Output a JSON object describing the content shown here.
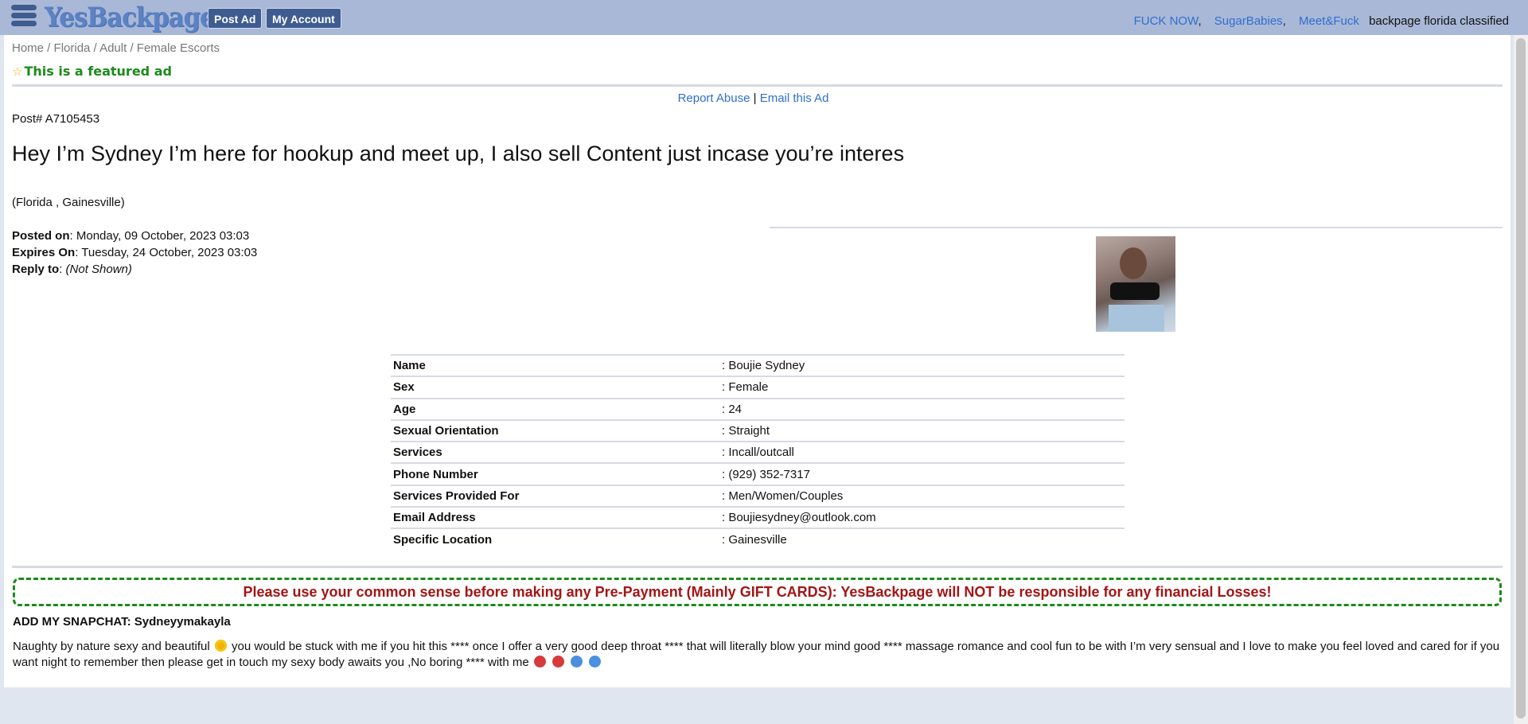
{
  "header": {
    "logo": "YesBackpage",
    "post_ad": "Post Ad",
    "my_account": "My Account",
    "links": [
      "FUCK NOW",
      "SugarBabies",
      "Meet&Fuck"
    ],
    "tagline": "backpage florida classified"
  },
  "breadcrumb": [
    "Home",
    "Florida",
    "Adult",
    "Female Escorts"
  ],
  "featured": "This is a featured ad",
  "actions": {
    "report": "Report Abuse",
    "email": "Email this Ad"
  },
  "post_number": "Post# A7105453",
  "title": "Hey I’m Sydney I’m here for hookup and meet up, I also sell Content just incase you’re interes",
  "location": "(Florida , Gainesville)",
  "meta": {
    "posted_label": "Posted on",
    "posted_value": ": Monday, 09 October, 2023  03:03",
    "expires_label": "Expires On",
    "expires_value": ": Tuesday, 24 October, 2023  03:03",
    "reply_label": "Reply to",
    "reply_value": "(Not Shown)"
  },
  "details": [
    {
      "k": "Name",
      "v": ": Boujie Sydney"
    },
    {
      "k": "Sex",
      "v": ": Female"
    },
    {
      "k": "Age",
      "v": ": 24"
    },
    {
      "k": "Sexual Orientation",
      "v": ": Straight"
    },
    {
      "k": "Services",
      "v": ": Incall/outcall"
    },
    {
      "k": "Phone Number",
      "v": ": (929) 352-7317"
    },
    {
      "k": "Services Provided For",
      "v": ": Men/Women/Couples"
    },
    {
      "k": "Email Address",
      "v": ": Boujiesydney@outlook.com"
    },
    {
      "k": "Specific Location",
      "v": ": Gainesville"
    }
  ],
  "warning": "Please use your common sense before making any Pre-Payment (Mainly GIFT CARDS): YesBackpage will NOT be responsible for any financial Losses!",
  "snapchat": "ADD MY SNAPCHAT: Sydneyymakayla",
  "description_a": "Naughty by nature sexy and beautiful",
  "description_b": "you would be stuck with me if you hit this **** once I offer a very good deep throat **** that will literally blow your mind good **** massage romance and cool fun to be with I’m very sensual and I love to make you feel loved and cared for if you want night to remember then please get in touch my sexy body awaits you ,No boring **** with me",
  "icons": {
    "menu": "hamburger-menu-icon",
    "featured": "star-icon",
    "emoji_1": "heart-eyes-emoji",
    "emoji_2": "red-face-emoji",
    "emoji_3": "blue-face-emoji"
  },
  "colors": {
    "topbar": "#a9b8d6",
    "nav_button": "#3e5c8f",
    "link": "#2f6fd0",
    "featured": "#1c8a1c",
    "warning_text": "#a31515",
    "warning_border": "#1c8a1c"
  }
}
